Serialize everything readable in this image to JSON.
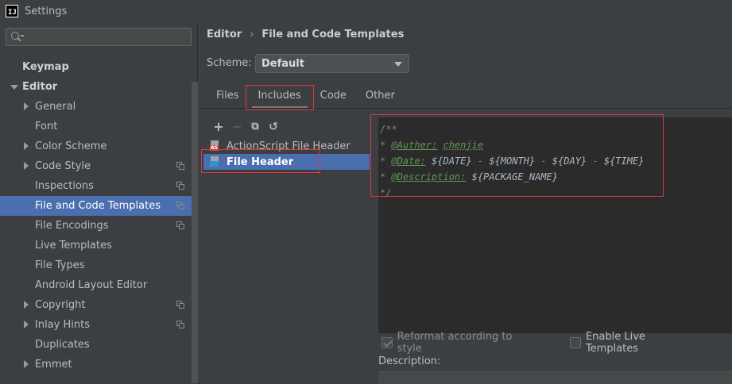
{
  "window": {
    "title": "Settings",
    "app_icon_text": "IJ"
  },
  "search": {
    "placeholder": ""
  },
  "sidebar": {
    "items": [
      {
        "label": "Keymap",
        "level": 0,
        "bold": true
      },
      {
        "label": "Editor",
        "level": 0,
        "bold": true,
        "expanded": true
      },
      {
        "label": "General",
        "level": 1,
        "has_children": true
      },
      {
        "label": "Font",
        "level": 1
      },
      {
        "label": "Color Scheme",
        "level": 1,
        "has_children": true
      },
      {
        "label": "Code Style",
        "level": 1,
        "has_children": true,
        "copy_icon": true
      },
      {
        "label": "Inspections",
        "level": 1,
        "copy_icon": true
      },
      {
        "label": "File and Code Templates",
        "level": 1,
        "copy_icon": true,
        "selected": true
      },
      {
        "label": "File Encodings",
        "level": 1,
        "copy_icon": true
      },
      {
        "label": "Live Templates",
        "level": 1
      },
      {
        "label": "File Types",
        "level": 1
      },
      {
        "label": "Android Layout Editor",
        "level": 1
      },
      {
        "label": "Copyright",
        "level": 1,
        "has_children": true,
        "copy_icon": true
      },
      {
        "label": "Inlay Hints",
        "level": 1,
        "has_children": true,
        "copy_icon": true
      },
      {
        "label": "Duplicates",
        "level": 1
      },
      {
        "label": "Emmet",
        "level": 1,
        "has_children": true
      }
    ]
  },
  "breadcrumb": {
    "parent": "Editor",
    "separator": "›",
    "current": "File and Code Templates"
  },
  "scheme": {
    "label": "Scheme:",
    "value": "Default"
  },
  "tabs": [
    {
      "label": "Files"
    },
    {
      "label": "Includes",
      "active": true
    },
    {
      "label": "Code"
    },
    {
      "label": "Other"
    }
  ],
  "toolbar": {
    "add": "+",
    "remove": "−",
    "copy": "⧉",
    "reset": "↺"
  },
  "templates": [
    {
      "name": "ActionScript File Header",
      "badge": "AS"
    },
    {
      "name": "File Header",
      "selected": true
    }
  ],
  "editor": {
    "open": "/**",
    "author_tag": "@Auther:",
    "author_value": "chenjie",
    "date_tag": "@Date:",
    "date_vars": [
      "${DATE}",
      "${MONTH}",
      "${DAY}",
      "${TIME}"
    ],
    "desc_tag": "@Description:",
    "desc_var": "${PACKAGE_NAME}",
    "close": "*/"
  },
  "options": {
    "reformat": "Reformat according to style",
    "reformat_checked": true,
    "live_templates": "Enable Live Templates",
    "live_checked": false
  },
  "description": {
    "label": "Description:"
  },
  "colors": {
    "selection": "#4b6eaf",
    "highlight_border": "#e0383e",
    "editor_bg": "#2b2b2b"
  }
}
